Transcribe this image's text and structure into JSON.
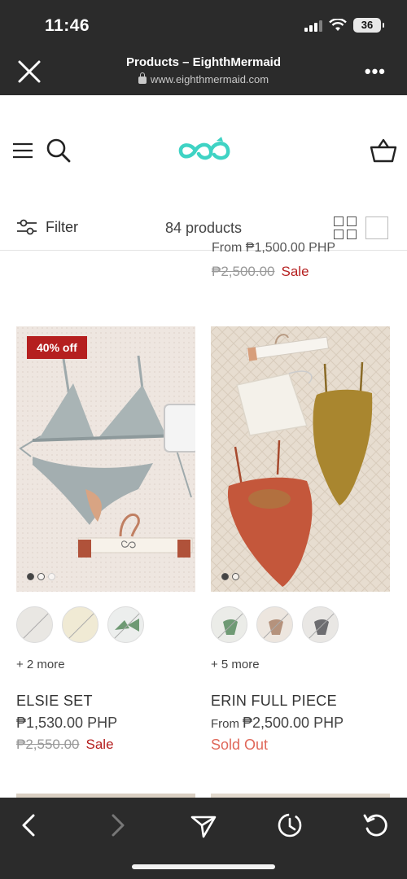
{
  "status_bar": {
    "time": "11:46",
    "battery": "36"
  },
  "browser": {
    "title": "Products – EighthMermaid",
    "url": "www.eighthmermaid.com",
    "more_label": "•••"
  },
  "site": {
    "logo_name": "EighthMermaid"
  },
  "filter_bar": {
    "filter_label": "Filter",
    "product_count": "84 products"
  },
  "partial_product": {
    "from_price": "From ₱1,500.00 PHP",
    "compare_price": "₱2,500.00",
    "sale_label": "Sale"
  },
  "products": [
    {
      "badge": "40% off",
      "name": "ELSIE SET",
      "price": "₱1,530.00 PHP",
      "compare_price": "₱2,550.00",
      "sale_label": "Sale",
      "more_swatches": "+ 2 more",
      "image_dots": 3,
      "active_dot": 0
    },
    {
      "name": "ERIN FULL PIECE",
      "price_prefix": "From",
      "price": "₱2,500.00 PHP",
      "status": "Sold Out",
      "more_swatches": "+ 5 more",
      "image_dots": 2,
      "active_dot": 0
    }
  ],
  "colors": {
    "sale_red": "#b51f1f",
    "sold_out": "#e0685a",
    "logo_teal": "#3fd3c4",
    "browser_chrome": "#2b2b2b"
  },
  "icons": [
    "close-icon",
    "lock-icon",
    "menu-icon",
    "search-icon",
    "logo-icon",
    "cart-icon",
    "filter-icon",
    "grid-four-icon",
    "grid-one-icon",
    "back-icon",
    "forward-icon",
    "share-icon",
    "history-icon",
    "reload-icon"
  ]
}
